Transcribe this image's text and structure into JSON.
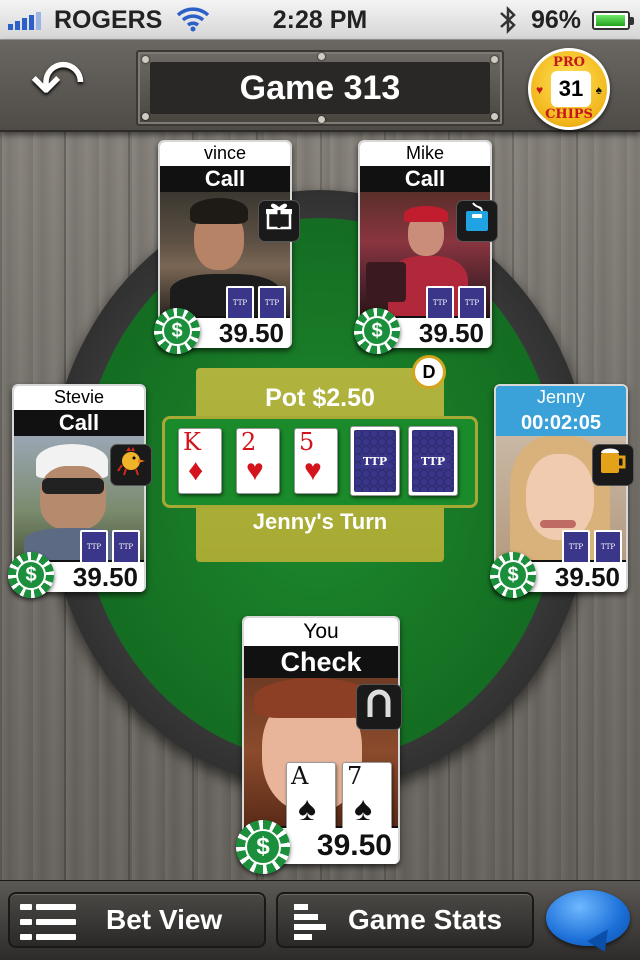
{
  "status": {
    "carrier": "ROGERS",
    "time": "2:28 PM",
    "battery": "96%",
    "battery_level": 0.96
  },
  "header": {
    "back_label": "↶",
    "title": "Game 313",
    "chips_top": "PRO",
    "chips_bottom": "CHIPS",
    "chips_count": "31"
  },
  "pot": {
    "label": "Pot $2.50",
    "turn": "Jenny's Turn",
    "dealer": "D"
  },
  "board": [
    {
      "rank": "K",
      "suit": "♦",
      "color": "red"
    },
    {
      "rank": "2",
      "suit": "♥",
      "color": "red"
    },
    {
      "rank": "5",
      "suit": "♥",
      "color": "red"
    },
    {
      "back": "TTP"
    },
    {
      "back": "TTP"
    }
  ],
  "players": {
    "vince": {
      "name": "vince",
      "action": "Call",
      "amount": "39.50",
      "gift": "gift-box-icon",
      "chip": "$",
      "cards": "TTP"
    },
    "mike": {
      "name": "Mike",
      "action": "Call",
      "amount": "39.50",
      "gift": "tissue-box-icon",
      "chip": "$",
      "cards": "TTP"
    },
    "stevie": {
      "name": "Stevie",
      "action": "Call",
      "amount": "39.50",
      "gift": "chicken-icon",
      "chip": "$",
      "cards": "TTP"
    },
    "jenny": {
      "name": "Jenny",
      "action": "00:02:05",
      "amount": "39.50",
      "gift": "beer-mug-icon",
      "chip": "$",
      "cards": "TTP"
    },
    "you": {
      "name": "You",
      "action": "Check",
      "amount": "39.50",
      "gift": "horseshoe-icon",
      "chip": "$",
      "hand": [
        {
          "rank": "A",
          "suit": "♠",
          "color": "black"
        },
        {
          "rank": "7",
          "suit": "♠",
          "color": "black"
        }
      ]
    }
  },
  "toolbar": {
    "bet_view": "Bet View",
    "game_stats": "Game Stats"
  },
  "colors": {
    "felt": "#1e8a2e",
    "pot_panel": "#b0b33e",
    "active_player": "#3aa2d9",
    "chip_green": "#1b8f3c"
  }
}
